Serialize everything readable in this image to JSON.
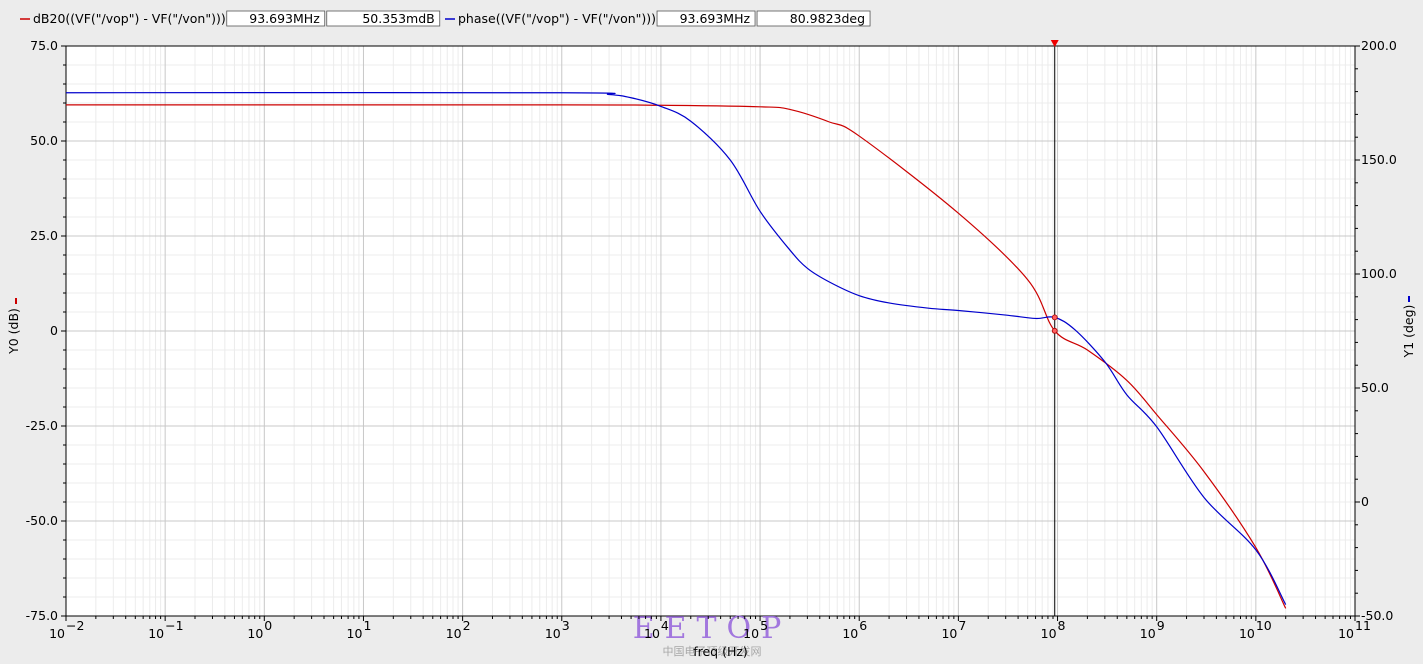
{
  "legend": [
    {
      "name": "dB20((VF(\"/vop\") - VF(\"/von\")))",
      "color": "#cc0000",
      "marker_x": "93.693MHz",
      "marker_y": "50.353mdB"
    },
    {
      "name": "phase((VF(\"/vop\") - VF(\"/von\")))",
      "color": "#0000cc",
      "marker_x": "93.693MHz",
      "marker_y": "80.9823deg"
    }
  ],
  "xlabel": "freq (Hz)",
  "ylabel_left": "Y0 (dB)",
  "ylabel_right": "Y1 (deg)",
  "watermark": {
    "logo": "EETOP",
    "subtitle": "中国电子顶级开发网"
  },
  "chart_data": {
    "type": "line",
    "x_scale": "log",
    "xlim": [
      0.01,
      100000000000
    ],
    "x_ticks": [
      {
        "b": "10",
        "e": "−2"
      },
      {
        "b": "10",
        "e": "−1"
      },
      {
        "b": "10",
        "e": "0"
      },
      {
        "b": "10",
        "e": "1"
      },
      {
        "b": "10",
        "e": "2"
      },
      {
        "b": "10",
        "e": "3"
      },
      {
        "b": "10",
        "e": "4"
      },
      {
        "b": "10",
        "e": "5"
      },
      {
        "b": "10",
        "e": "6"
      },
      {
        "b": "10",
        "e": "7"
      },
      {
        "b": "10",
        "e": "8"
      },
      {
        "b": "10",
        "e": "9"
      },
      {
        "b": "10",
        "e": "10"
      },
      {
        "b": "10",
        "e": "11"
      }
    ],
    "y_left": {
      "lim": [
        -75,
        75
      ],
      "ticks": [
        "75.0",
        "50.0",
        "25.0",
        "0",
        "-25.0",
        "-50.0",
        "-75.0"
      ]
    },
    "y_right": {
      "lim": [
        -50,
        200
      ],
      "ticks": [
        "200.0",
        "150.0",
        "100.0",
        "50.0",
        "0",
        "-50.0"
      ]
    },
    "grid": true,
    "cursor_x": 93693000,
    "series": [
      {
        "name": "dB20((VF(\"/vop\") - VF(\"/von\")))",
        "axis": "left",
        "color": "#cc0000",
        "x": [
          0.01,
          1000,
          10000,
          100000,
          200000,
          500000,
          1000000,
          10000000,
          50000000,
          93693000,
          200000000,
          500000000,
          1000000000,
          3000000000,
          10000000000,
          20000000000
        ],
        "y": [
          59.5,
          59.5,
          59.4,
          59.0,
          58.3,
          55.0,
          51.3,
          31.0,
          13.5,
          0.05,
          -5.0,
          -13.0,
          -22.0,
          -37.0,
          -57.0,
          -73.0
        ]
      },
      {
        "name": "phase((VF(\"/vop\") - VF(\"/von\")))",
        "axis": "right",
        "color": "#0000cc",
        "x": [
          0.01,
          1000,
          3000,
          5000,
          10000,
          20000,
          50000,
          100000,
          200000,
          300000,
          500000,
          1000000,
          2000000,
          5000000,
          10000000,
          30000000,
          60000000,
          93693000,
          150000000,
          300000000,
          500000000,
          1000000000,
          3000000000,
          10000000000,
          20000000000
        ],
        "y": [
          179.5,
          179.5,
          178.7,
          177.3,
          173.5,
          167,
          150,
          127.5,
          110.5,
          102.5,
          96.5,
          90.5,
          87.3,
          85.0,
          84.0,
          82.0,
          80.5,
          80.98,
          75.5,
          61.5,
          47.0,
          33.0,
          2.0,
          -21.0,
          -45.0
        ]
      }
    ]
  }
}
